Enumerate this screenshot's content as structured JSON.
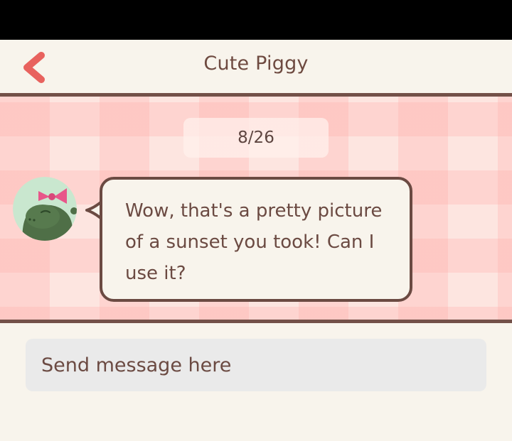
{
  "header": {
    "title": "Cute Piggy",
    "back_icon": "chevron-left-icon",
    "accent_color": "#e8625e"
  },
  "chat": {
    "date": "8/26",
    "messages": [
      {
        "sender_avatar": "green-character-with-pink-bow",
        "text": "Wow, that's a pretty picture of a sunset you took! Can I use it?"
      }
    ]
  },
  "composer": {
    "placeholder": "Send message here"
  },
  "colors": {
    "background": "#f8f4ec",
    "divider": "#735048",
    "chat_background": "#fde5e0",
    "input_background": "#eaeaea",
    "text": "#6b4a42"
  }
}
